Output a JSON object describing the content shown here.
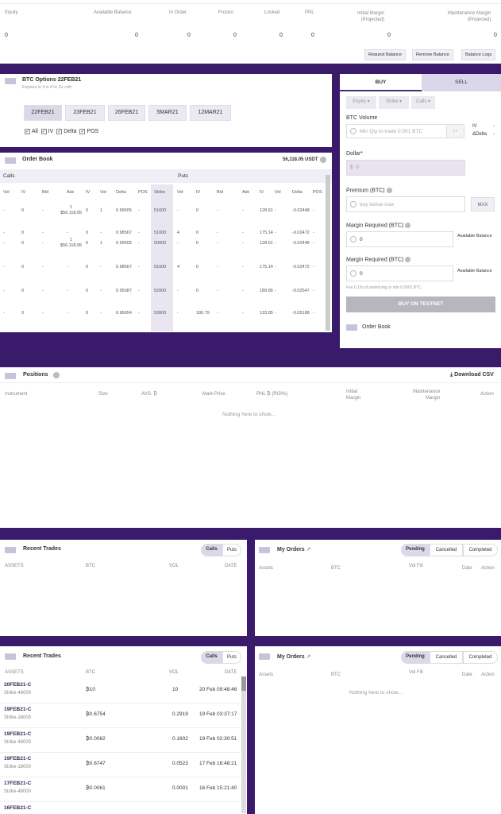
{
  "balance": {
    "headers": [
      "Equity",
      "Available Balance",
      "In Order",
      "Frozen",
      "Locked",
      "PNL",
      "Initial Margin\n(Projected)",
      "Maintenance Margin\n(Projected)"
    ],
    "values": [
      "0",
      "0",
      "0",
      "0",
      "0",
      "0",
      "0",
      "0"
    ],
    "buttons": {
      "request": "Request Balance",
      "remove": "Remove Balance",
      "logs": "Balance Logs"
    }
  },
  "options": {
    "title": "BTC Options 22FEB21",
    "subtitle": "Expires in 0 d 4 hr 2x mth",
    "expiries": [
      "22FEB21",
      "23FEB21",
      "26FEB21",
      "5MAR21",
      "12MAR21"
    ],
    "filters": [
      "All",
      "IV",
      "Delta",
      "POS"
    ]
  },
  "orderbook": {
    "title": "Order Book",
    "price": "56,118.05 USDT",
    "calls_label": "Calls",
    "puts_label": "Puts",
    "headers": [
      "Vol",
      "IV",
      "Bid",
      "Ask",
      "IV",
      "Vol",
      "Delta",
      "POS",
      "Strike",
      "Vol",
      "IV",
      "Bid",
      "Ask",
      "IV",
      "Vol",
      "Delta",
      "POS"
    ],
    "rows": [
      {
        "c_vol": "-",
        "c_iv": "0",
        "c_bid": "-",
        "c_ask": "1\n$56,118.05",
        "c_iv2": "0",
        "c_vol2": "1",
        "c_delta": "0.99505",
        "c_pos": "-",
        "strike": "51600",
        "p_vol": "-",
        "p_iv": "0",
        "p_bid": "-",
        "p_ask": "-",
        "p_iv2": "128.61",
        "p_vol2": "-",
        "p_delta": "-0.02448",
        "p_pos": "-"
      },
      {
        "c_vol": "-",
        "c_iv": "0",
        "c_bid": "-",
        "c_ask": "-",
        "c_iv2": "0",
        "c_vol2": "-",
        "c_delta": "0.98567",
        "c_pos": "-",
        "strike": "51000",
        "p_vol": "4",
        "p_iv": "0",
        "p_bid": "-",
        "p_ask": "-",
        "p_iv2": "175.14",
        "p_vol2": "-",
        "p_delta": "-0.02472",
        "p_pos": "-"
      },
      {
        "c_vol": "-",
        "c_iv": "0",
        "c_bid": "-",
        "c_ask": "1\n$56,118.05",
        "c_iv2": "0",
        "c_vol2": "1",
        "c_delta": "0.99505",
        "c_pos": "-",
        "strike": "50000",
        "p_vol": "-",
        "p_iv": "0",
        "p_bid": "-",
        "p_ask": "-",
        "p_iv2": "128.61",
        "p_vol2": "-",
        "p_delta": "-0.02448",
        "p_pos": "-"
      },
      {
        "c_vol": "-",
        "c_iv": "0",
        "c_bid": "-",
        "c_ask": "-",
        "c_iv2": "0",
        "c_vol2": "-",
        "c_delta": "0.98567",
        "c_pos": "-",
        "strike": "51600",
        "p_vol": "4",
        "p_iv": "0",
        "p_bid": "-",
        "p_ask": "-",
        "p_iv2": "175.14",
        "p_vol2": "-",
        "p_delta": "-0.02472",
        "p_pos": "-"
      },
      {
        "c_vol": "-",
        "c_iv": "0",
        "c_bid": "-",
        "c_ask": "-",
        "c_iv2": "0",
        "c_vol2": "-",
        "c_delta": "0.95087",
        "c_pos": "-",
        "strike": "52000",
        "p_vol": "-",
        "p_iv": "0",
        "p_bid": "-",
        "p_ask": "-",
        "p_iv2": "189.86",
        "p_vol2": "-",
        "p_delta": "-0.02547",
        "p_pos": "-"
      },
      {
        "c_vol": "-",
        "c_iv": "0",
        "c_bid": "-",
        "c_ask": "-",
        "c_iv2": "0",
        "c_vol2": "-",
        "c_delta": "0.96654",
        "c_pos": "-",
        "strike": "53000",
        "p_vol": "-",
        "p_iv": "180.79",
        "p_bid": "-",
        "p_ask": "-",
        "p_iv2": "133.85",
        "p_vol2": "-",
        "p_delta": "-0.05188",
        "p_pos": "-"
      }
    ]
  },
  "trade": {
    "buy": "BUY",
    "sell": "SELL",
    "dropdowns": [
      "Expiry",
      "Strike",
      "Calls"
    ],
    "btc_volume": "BTC Volume",
    "btc_volume_ph": "Min Qty to trade 0.001 BTC",
    "iv": "IV",
    "delta": "ΔDelta",
    "dollar": "Dollar*",
    "dollar_val": "0",
    "dollar_sym": "$",
    "premium": "Premium (BTC)",
    "premium_ph": "buy below max",
    "max": "MAX",
    "margin1": "Margin Required (BTC)",
    "margin1_val": "0",
    "margin2": "Margin Required (BTC)",
    "margin2_val": "0",
    "avail": "Available Balance",
    "fee": "Fee 0.1% of underlying or min 0.0001 BTC",
    "submit": "BUY ON TESTNET",
    "orderbook": "Order Book"
  },
  "positions": {
    "title": "Positions",
    "download": "Download CSV",
    "headers": [
      "Instrument",
      "Size",
      "AVG. ₿",
      "Mark Price",
      "PNL ₿ (ROI%)",
      "Initial\nMargin",
      "Maintenance\nMargin",
      "Action"
    ],
    "empty": "Nothing here to show..."
  },
  "trades1": {
    "title": "Recent Trades",
    "calls": "Calls",
    "puts": "Puts",
    "headers": [
      "ASSETS",
      "BTC",
      "VOL",
      "DATE"
    ]
  },
  "orders1": {
    "title": "My Orders",
    "tabs": [
      "Pending",
      "Cancelled",
      "Completed"
    ],
    "headers": [
      "Assets",
      "BTC",
      "Vol Fill",
      "Date",
      "Action"
    ]
  },
  "trades2": {
    "title": "Recent Trades",
    "calls": "Calls",
    "puts": "Puts",
    "headers": [
      "ASSETS",
      "BTC",
      "VOL",
      "DATE"
    ],
    "rows": [
      {
        "asset": "20FEB21-C",
        "strike": "Strike-46000",
        "btc": "₿10",
        "vol": "10",
        "date": "20 Feb 09:48:46"
      },
      {
        "asset": "19FEB21-C",
        "strike": "Strike-16000",
        "btc": "₿0.6754",
        "vol": "0.2919",
        "date": "19 Feb 03:37:17"
      },
      {
        "asset": "19FEB21-C",
        "strike": "Strike-48000",
        "btc": "₿0.0082",
        "vol": "0.1602",
        "date": "19 Feb 02:30:51"
      },
      {
        "asset": "19FEB21-C",
        "strike": "Strike-16000",
        "btc": "₿0.6747",
        "vol": "0.0523",
        "date": "17 Feb 16:48:21"
      },
      {
        "asset": "17FEB21-C",
        "strike": "Strike-48000",
        "btc": "₿0.0061",
        "vol": "0.0001",
        "date": "16 Feb 15:21:40"
      },
      {
        "asset": "16FEB21-C",
        "strike": "",
        "btc": "",
        "vol": "",
        "date": ""
      }
    ]
  },
  "orders2": {
    "title": "My Orders",
    "tabs": [
      "Pending",
      "Cancelled",
      "Completed"
    ],
    "headers": [
      "Assets",
      "BTC",
      "Vol Fill",
      "Date",
      "Action"
    ],
    "empty": "Nothing here to show..."
  }
}
